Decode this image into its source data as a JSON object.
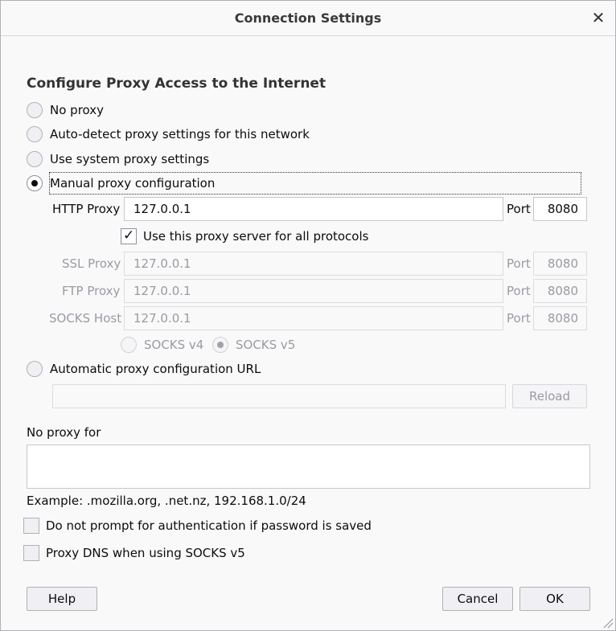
{
  "window": {
    "title": "Connection Settings",
    "close_icon": "close-icon"
  },
  "section": {
    "heading": "Configure Proxy Access to the Internet"
  },
  "proxy_options": {
    "no_proxy": "No proxy",
    "auto_detect": "Auto-detect proxy settings for this network",
    "system": "Use system proxy settings",
    "manual": "Manual proxy configuration",
    "selected": "manual"
  },
  "manual": {
    "http_label": "HTTP Proxy",
    "http_value": "127.0.0.1",
    "port_label": "Port",
    "http_port": "8080",
    "all_protocols_label": "Use this proxy server for all protocols",
    "all_protocols_checked": true,
    "ssl_label": "SSL Proxy",
    "ssl_value": "127.0.0.1",
    "ssl_port": "8080",
    "ftp_label": "FTP Proxy",
    "ftp_value": "127.0.0.1",
    "ftp_port": "8080",
    "socks_label": "SOCKS Host",
    "socks_value": "127.0.0.1",
    "socks_port": "8080",
    "socks_v4": "SOCKS v4",
    "socks_v5": "SOCKS v5",
    "socks_selected": "v5"
  },
  "auto_config": {
    "label": "Automatic proxy configuration URL",
    "url_value": "",
    "reload_label": "Reload"
  },
  "no_proxy_for": {
    "label": "No proxy for",
    "value": "",
    "example": "Example: .mozilla.org, .net.nz, 192.168.1.0/24"
  },
  "options": {
    "no_prompt_auth": "Do not prompt for authentication if password is saved",
    "no_prompt_auth_checked": false,
    "proxy_dns": "Proxy DNS when using SOCKS v5",
    "proxy_dns_checked": false
  },
  "buttons": {
    "help": "Help",
    "cancel": "Cancel",
    "ok": "OK"
  }
}
